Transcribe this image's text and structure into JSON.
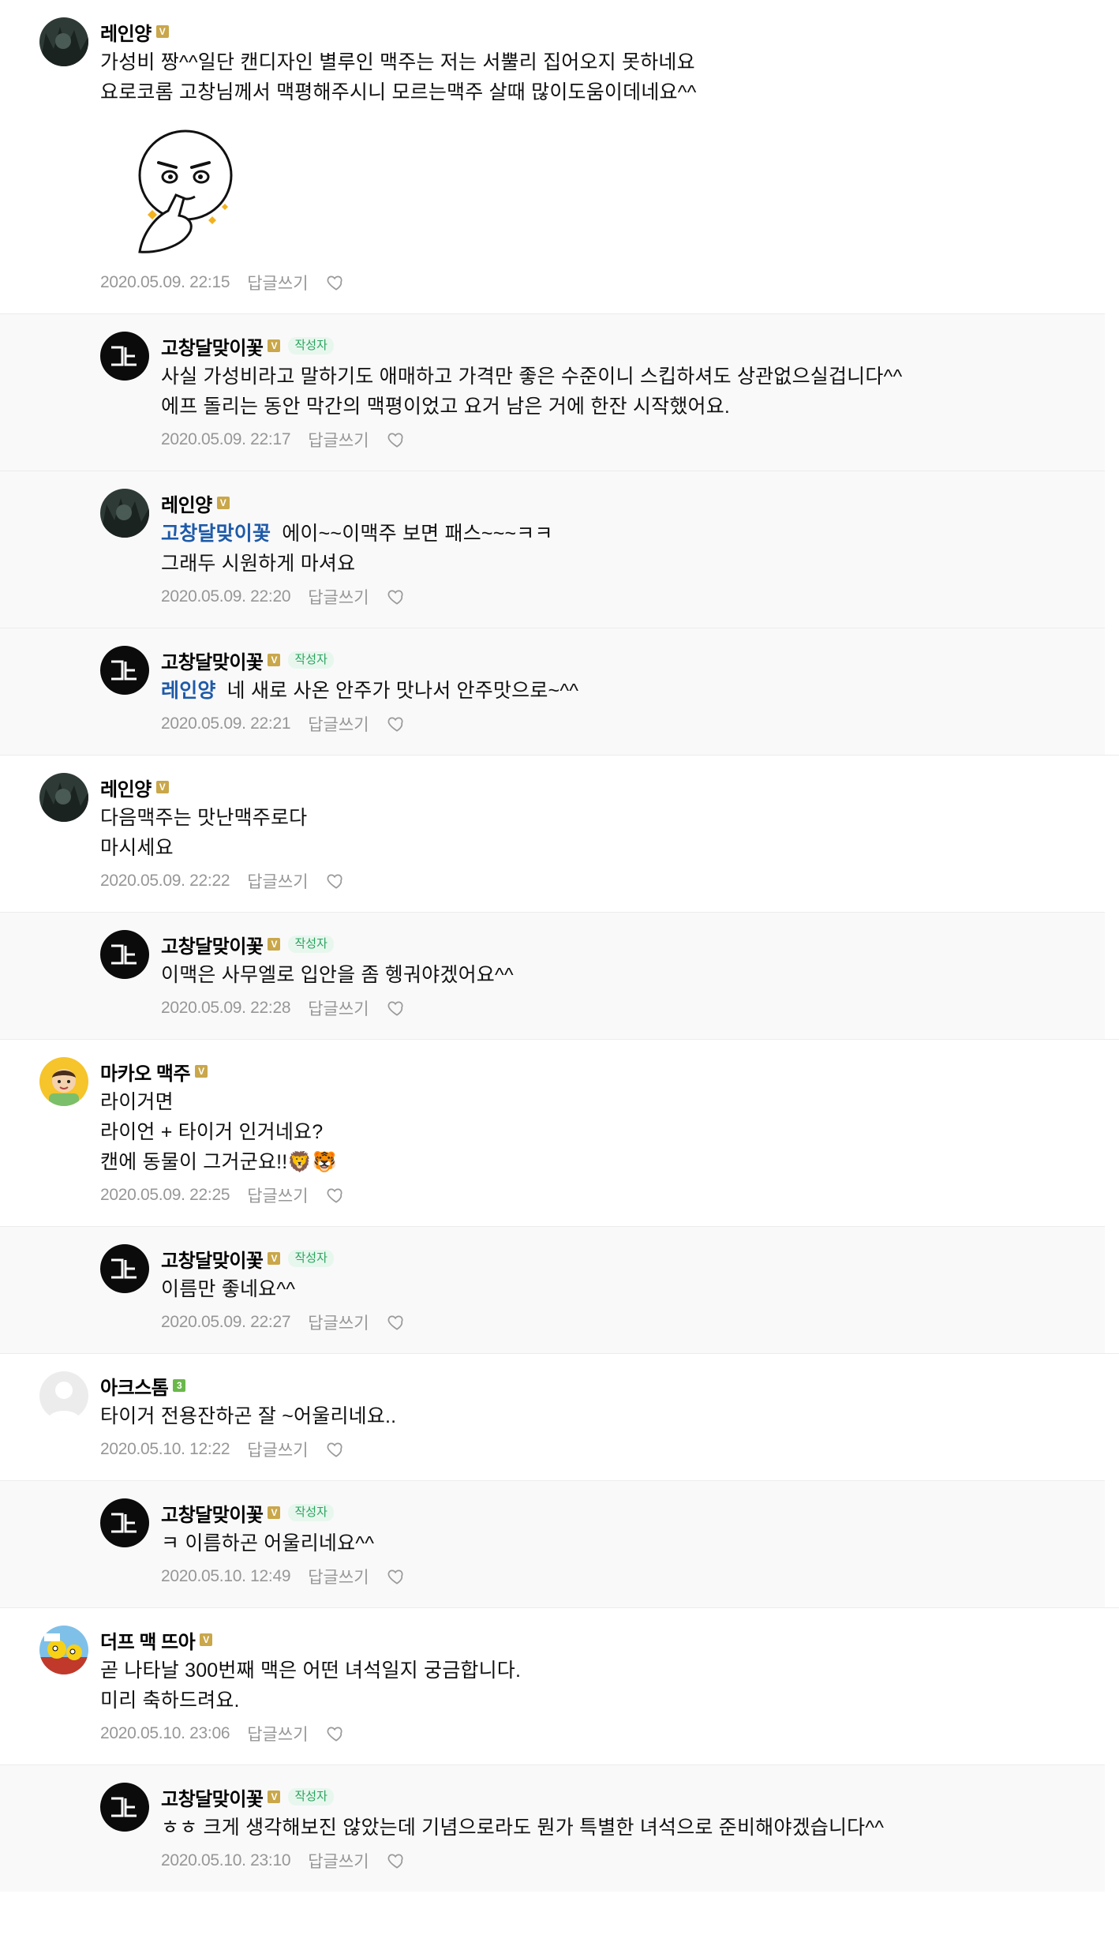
{
  "comments": [
    {
      "type": "top",
      "avatar": "dark-photo",
      "nick": "레인양",
      "badge": "V",
      "lines": [
        "가성비 짱^^일단 캔디자인 별루인 맥주는 저는 서뿔리 집어오지 못하네요",
        "요로코롬 고창님께서 맥평해주시니 모르는맥주 살때 많이도움이데네요^^"
      ],
      "sticker": true,
      "date": "2020.05.09. 22:15",
      "reply": "답글쓰기"
    },
    {
      "type": "reply",
      "avatar": "black-logo",
      "nick": "고창달맞이꽃",
      "badge": "V",
      "writer": "작성자",
      "lines": [
        "사실 가성비라고 말하기도 애매하고 가격만 좋은 수준이니 스킵하셔도 상관없으실겁니다^^",
        "에프 돌리는 동안 막간의 맥평이었고 요거 남은 거에 한잔 시작했어요."
      ],
      "date": "2020.05.09. 22:17",
      "reply": "답글쓰기"
    },
    {
      "type": "reply",
      "avatar": "dark-photo",
      "nick": "레인양",
      "badge": "V",
      "mention": "고창달맞이꽃",
      "lines": [
        "에이~~이맥주 보면 패스~~~ㅋㅋ",
        "그래두 시원하게 마셔요"
      ],
      "date": "2020.05.09. 22:20",
      "reply": "답글쓰기"
    },
    {
      "type": "reply",
      "avatar": "black-logo",
      "nick": "고창달맞이꽃",
      "badge": "V",
      "writer": "작성자",
      "mention": "레인양",
      "lines": [
        "네 새로 사온 안주가 맛나서 안주맛으로~^^"
      ],
      "date": "2020.05.09. 22:21",
      "reply": "답글쓰기"
    },
    {
      "type": "top",
      "avatar": "dark-photo",
      "nick": "레인양",
      "badge": "V",
      "lines": [
        "다음맥주는 맛난맥주로다",
        "마시세요"
      ],
      "date": "2020.05.09. 22:22",
      "reply": "답글쓰기"
    },
    {
      "type": "reply",
      "avatar": "black-logo",
      "nick": "고창달맞이꽃",
      "badge": "V",
      "writer": "작성자",
      "lines": [
        "이맥은 사무엘로 입안을 좀 헹궈야겠어요^^"
      ],
      "date": "2020.05.09. 22:28",
      "reply": "답글쓰기"
    },
    {
      "type": "top",
      "avatar": "cartoon-boy",
      "nick": "마카오 맥주",
      "badge": "V",
      "lines": [
        "라이거면",
        "라이언 + 타이거 인거네요?",
        "캔에 동물이 그거군요!!🦁🐯"
      ],
      "date": "2020.05.09. 22:25",
      "reply": "답글쓰기"
    },
    {
      "type": "reply",
      "avatar": "black-logo",
      "nick": "고창달맞이꽃",
      "badge": "V",
      "writer": "작성자",
      "lines": [
        "이름만 좋네요^^"
      ],
      "date": "2020.05.09. 22:27",
      "reply": "답글쓰기"
    },
    {
      "type": "top",
      "avatar": "default",
      "nick": "아크스톰",
      "badge": "3",
      "lines": [
        "타이거 전용잔하곤 잘 ~어울리네요.."
      ],
      "date": "2020.05.10. 12:22",
      "reply": "답글쓰기"
    },
    {
      "type": "reply",
      "avatar": "black-logo",
      "nick": "고창달맞이꽃",
      "badge": "V",
      "writer": "작성자",
      "lines": [
        "ㅋ 이름하곤 어울리네요^^"
      ],
      "date": "2020.05.10. 12:49",
      "reply": "답글쓰기"
    },
    {
      "type": "top",
      "avatar": "simpsons",
      "nick": "더프 맥 뜨아",
      "badge": "V",
      "lines": [
        "곧 나타날 300번째 맥은 어떤 녀석일지 궁금합니다.",
        "미리 축하드려요."
      ],
      "date": "2020.05.10. 23:06",
      "reply": "답글쓰기"
    },
    {
      "type": "reply",
      "avatar": "black-logo",
      "nick": "고창달맞이꽃",
      "badge": "V",
      "writer": "작성자",
      "lines": [
        "ㅎㅎ 크게 생각해보진 않았는데 기념으로라도 뭔가 특별한 녀석으로 준비해야겠습니다^^"
      ],
      "date": "2020.05.10. 23:10",
      "reply": "답글쓰기"
    }
  ],
  "colors": {
    "mention": "#1e5aa8",
    "writer_tag": "#2aa35f",
    "meta": "#979797",
    "reply_bg": "#f9f9fa"
  }
}
